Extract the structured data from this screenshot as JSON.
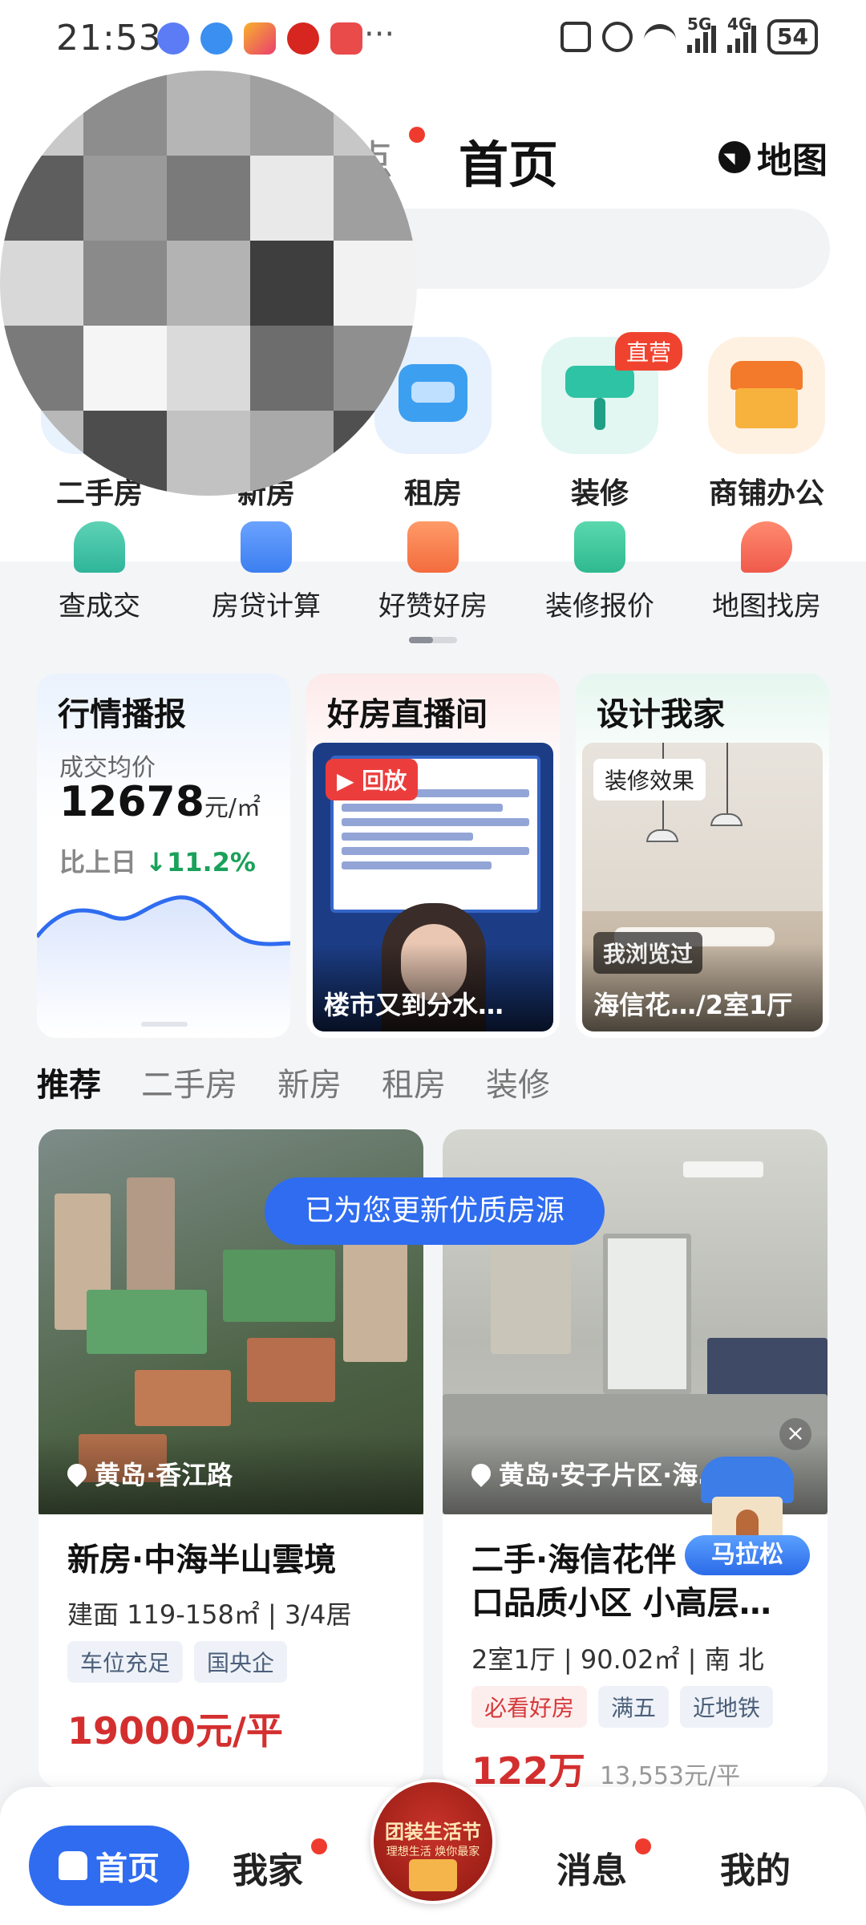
{
  "status_bar": {
    "time": "21:53",
    "overflow": "···",
    "signal_5g": "5G",
    "signal_4g": "4G",
    "battery": "54",
    "app_icons": [
      "music-icon",
      "browser-icon",
      "app-store-icon",
      "metro-icon",
      "huawei-icon"
    ],
    "status_icons": [
      "nfc-icon",
      "alarm-icon",
      "wifi-icon"
    ]
  },
  "header": {
    "tab_partial": "点",
    "title": "首页",
    "map_label": "地图"
  },
  "categories": [
    {
      "label": "二手房",
      "icon": "second-hand-house-icon",
      "color": "#3aa0f0"
    },
    {
      "label": "新房",
      "icon": "new-house-icon",
      "color": "#f3a33b"
    },
    {
      "label": "租房",
      "icon": "armchair-icon",
      "color": "#3d9ff0"
    },
    {
      "label": "装修",
      "icon": "paint-roller-icon",
      "color": "#2ec3a4",
      "badge": "直营"
    },
    {
      "label": "商铺办公",
      "icon": "shop-icon",
      "color": "#f59a2a"
    }
  ],
  "tools": [
    {
      "label": "查成交",
      "icon": "stamp-icon",
      "color": "#2fb59a"
    },
    {
      "label": "房贷计算",
      "icon": "calculator-icon",
      "color": "#3c7ff0"
    },
    {
      "label": "好赞好房",
      "icon": "thumbs-up-icon",
      "color": "#f36c3e"
    },
    {
      "label": "装修报价",
      "icon": "price-tag-icon",
      "color": "#2fb98f"
    },
    {
      "label": "地图找房",
      "icon": "map-pin-icon",
      "color": "#ef5a4a"
    }
  ],
  "market_card": {
    "title": "行情播报",
    "label": "成交均价",
    "price": "12678",
    "unit": "元/㎡",
    "compare_label": "比上日",
    "change": "↓11.2%",
    "trend_color": "#2f6cf0"
  },
  "live_card": {
    "title": "好房直播间",
    "replay": "回放",
    "caption": "楼市又到分水…"
  },
  "design_card": {
    "title": "设计我家",
    "tag": "装修效果",
    "seen": "我浏览过",
    "caption": "海信花…/2室1厅"
  },
  "feed_tabs": [
    "推荐",
    "二手房",
    "新房",
    "租房",
    "装修"
  ],
  "toast": "已为您更新优质房源",
  "listings": [
    {
      "location": "黄岛·香江路",
      "title": "新房·中海半山雲境",
      "subtitle": "建面 119-158㎡ | 3/4居",
      "tags": [
        "车位充足",
        "国央企"
      ],
      "price": "19000元/平"
    },
    {
      "location": "黄岛·安子片区·海…",
      "title_line1": "二手·海信花伴",
      "title_line2": "口品质小区 小高层…",
      "subtitle": "2室1厅 | 90.02㎡ | 南 北",
      "tags": [
        "必看好房",
        "满五",
        "近地铁"
      ],
      "price": "122万",
      "unit_price": "13,553元/平"
    }
  ],
  "floating_ad": {
    "label": "马拉松",
    "close": "×"
  },
  "bottom_nav": {
    "home": "首页",
    "myhome": "我家",
    "promo": "团装生活节",
    "promo_sub": "理想生活 焕你最家",
    "messages": "消息",
    "mine": "我的"
  },
  "colors": {
    "accent": "#2f6cf0",
    "price_red": "#d42f2f",
    "badge_red": "#ef3b2d",
    "up_green": "#1aa15a"
  }
}
